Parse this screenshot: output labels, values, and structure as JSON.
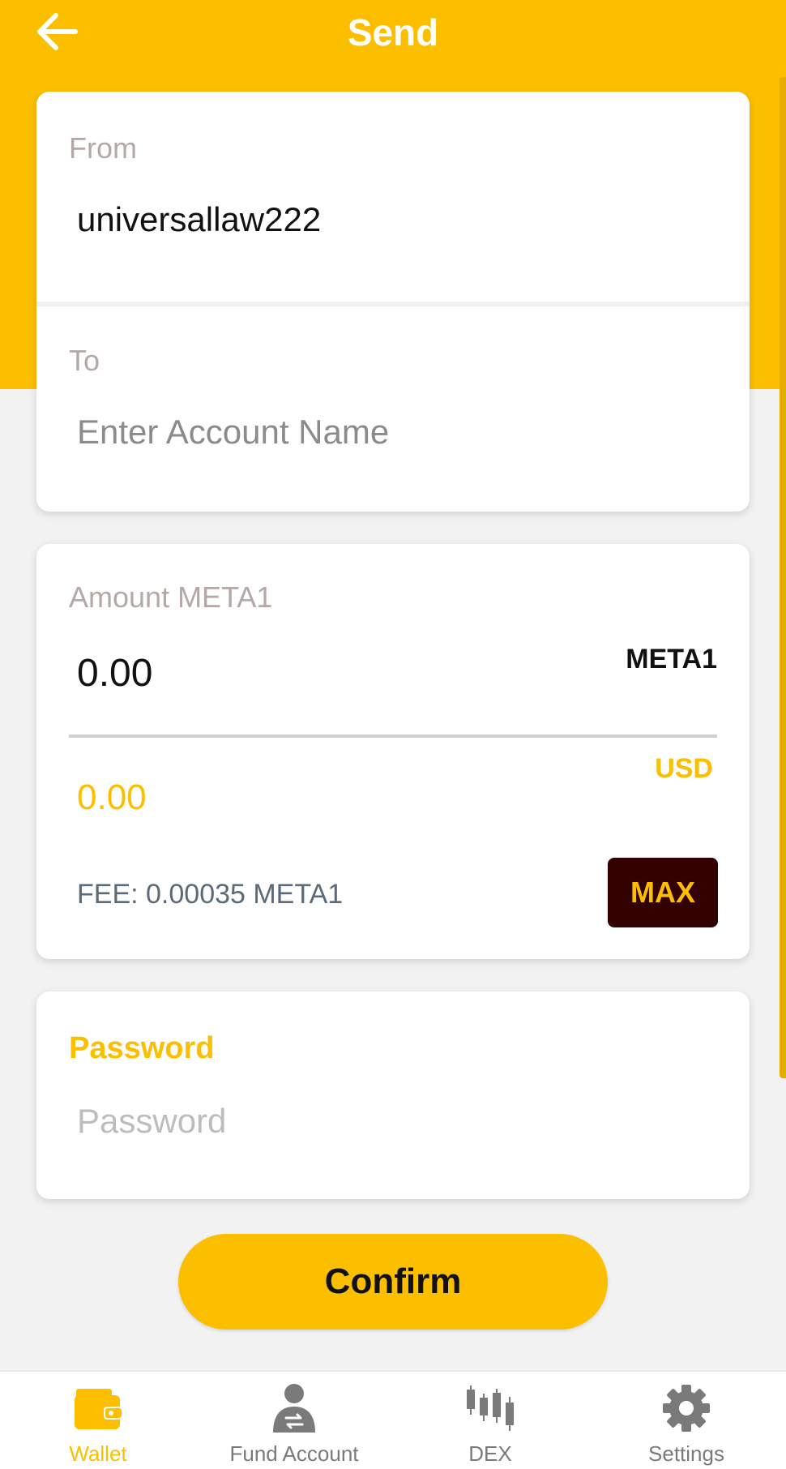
{
  "header": {
    "title": "Send",
    "back_icon": "arrow-left-icon"
  },
  "from_card": {
    "from_label": "From",
    "from_value": "universallaw222",
    "to_label": "To",
    "to_placeholder": "Enter Account Name",
    "to_value": ""
  },
  "amount_card": {
    "label": "Amount META1",
    "amount_value": "0.00",
    "amount_unit": "META1",
    "usd_value": "0.00",
    "usd_unit": "USD",
    "fee": "FEE: 0.00035 META1",
    "max_label": "MAX"
  },
  "password_card": {
    "label": "Password",
    "placeholder": "Password",
    "value": ""
  },
  "confirm_label": "Confirm",
  "bottom_nav": {
    "items": [
      {
        "label": "Wallet",
        "icon": "wallet-icon",
        "active": true
      },
      {
        "label": "Fund Account",
        "icon": "fund-account-icon",
        "active": false
      },
      {
        "label": "DEX",
        "icon": "candlestick-chart-icon",
        "active": false
      },
      {
        "label": "Settings",
        "icon": "gear-icon",
        "active": false
      }
    ]
  },
  "colors": {
    "accent": "#fcbf00",
    "max_button_bg": "#330000",
    "background": "#f2f2f2"
  }
}
